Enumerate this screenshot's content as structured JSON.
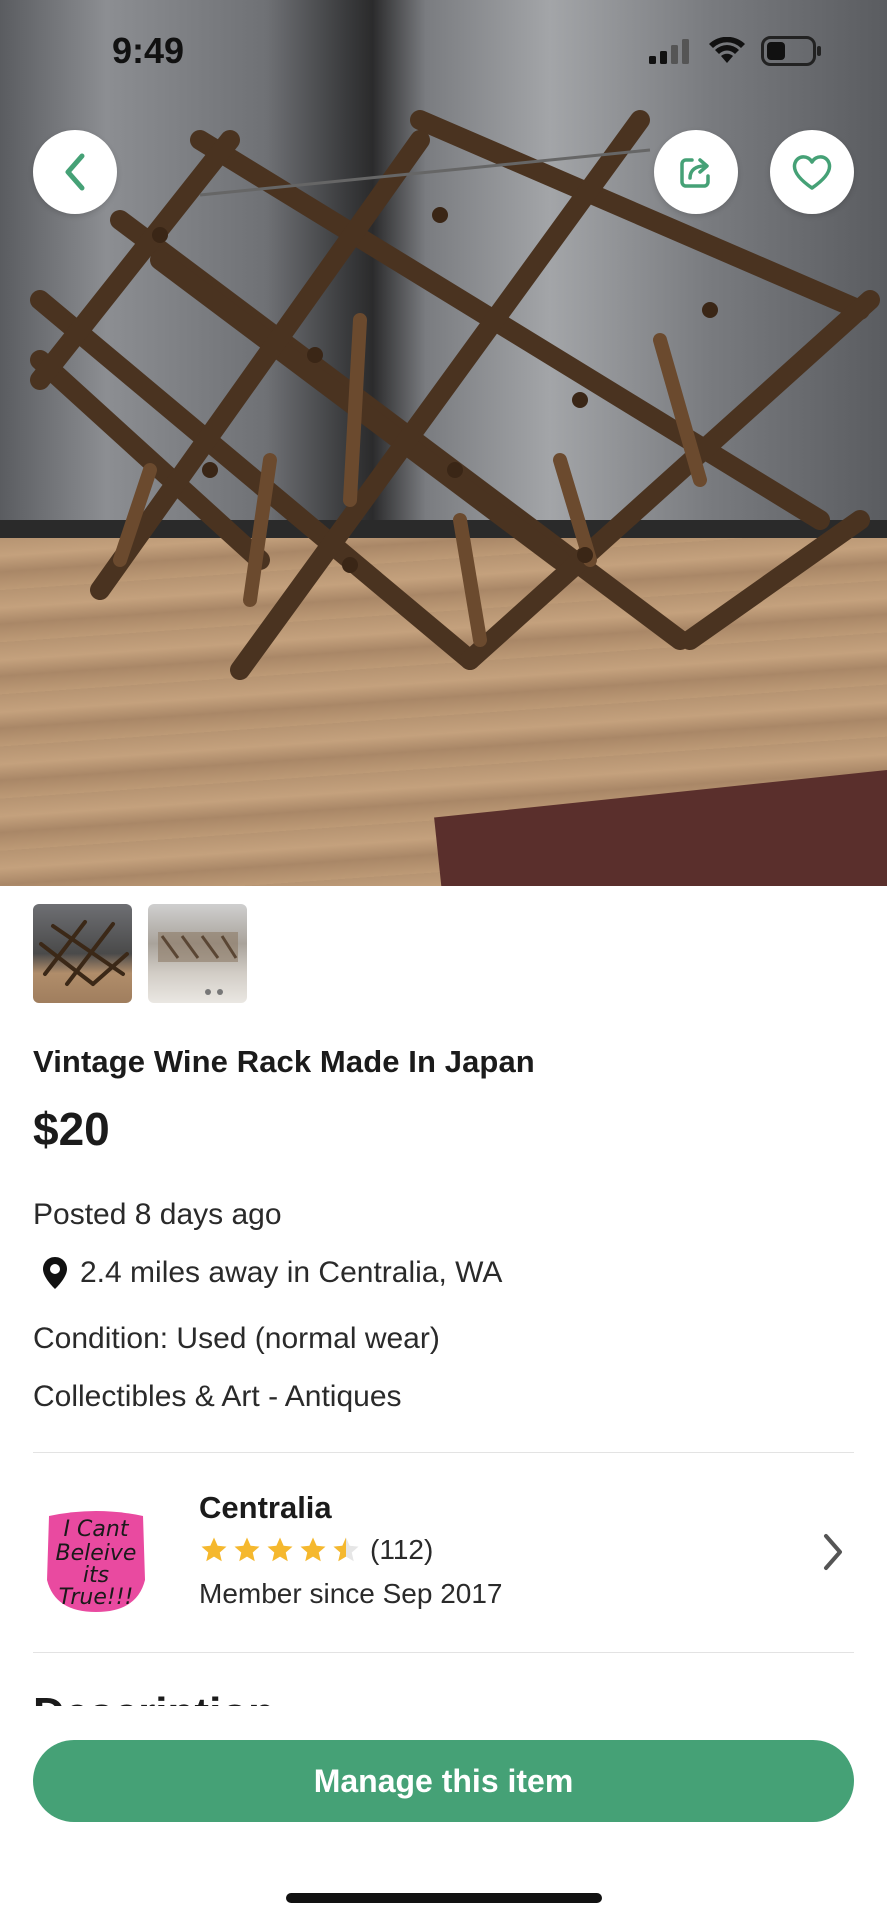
{
  "status_bar": {
    "time": "9:49",
    "icons": [
      "signal-icon",
      "wifi-icon",
      "battery-icon"
    ]
  },
  "photo": {
    "alt": "Vintage wooden wine rack"
  },
  "nav": {
    "back_icon": "chevron-left-icon",
    "share_icon": "share-icon",
    "favorite_icon": "heart-icon"
  },
  "listing": {
    "title": "Vintage Wine Rack Made In Japan",
    "price": "$20",
    "posted": "Posted 8 days ago",
    "location": "2.4 miles away in Centralia, WA",
    "condition": "Condition: Used (normal wear)",
    "category": "Collectibles & Art - Antiques"
  },
  "seller": {
    "name": "Centralia",
    "rating": 4.5,
    "rating_max": 5,
    "reviews": "(112)",
    "member_since": "Member since Sep 2017",
    "avatar_text": [
      "I Cant",
      "Beleive",
      "its",
      "True!!!"
    ]
  },
  "description_heading": "Description",
  "cta": {
    "label": "Manage this item"
  },
  "colors": {
    "accent": "#45a176",
    "star": "#f5b82e",
    "avatar_bg": "#e94aa0"
  }
}
